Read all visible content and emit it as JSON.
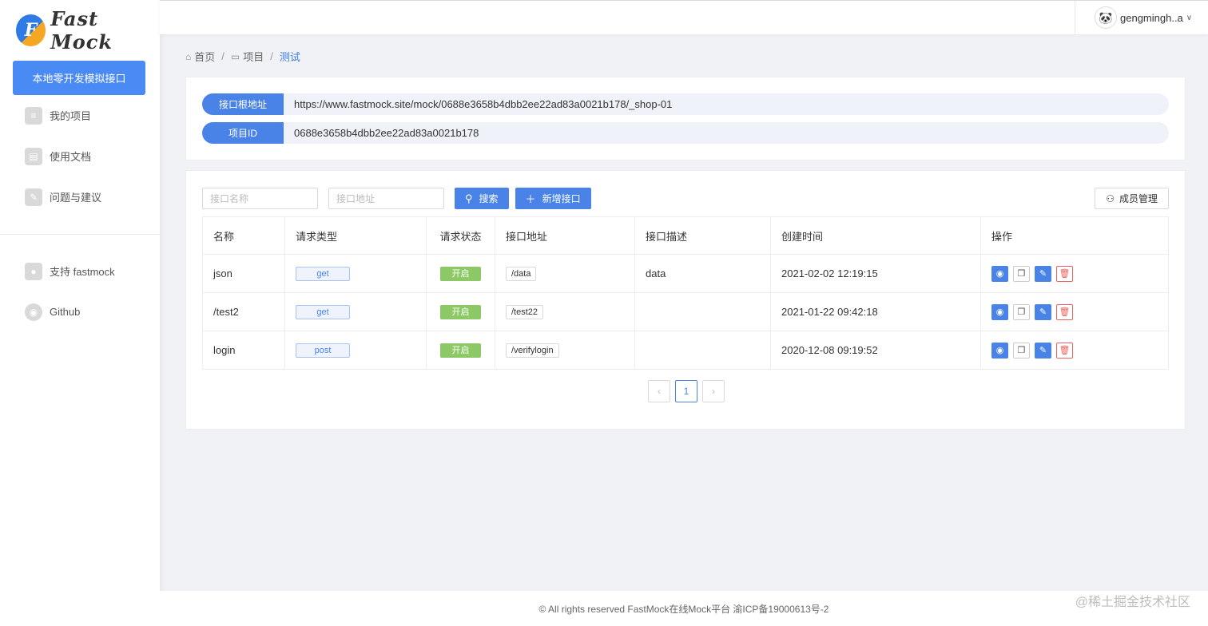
{
  "app": {
    "logo_mark": "F",
    "logo_text": "Fast Mock"
  },
  "sidebar": {
    "cta_label": "本地零开发模拟接口",
    "items": [
      {
        "label": "我的项目",
        "icon": "list-icon"
      },
      {
        "label": "使用文档",
        "icon": "book-icon"
      },
      {
        "label": "问题与建议",
        "icon": "feedback-icon"
      }
    ],
    "extra_items": [
      {
        "label": "支持 fastmock",
        "icon": "drop-icon"
      },
      {
        "label": "Github",
        "icon": "github-icon"
      }
    ]
  },
  "header": {
    "username": "gengmingh..a",
    "avatar_glyph": "🐼"
  },
  "breadcrumb": {
    "home": "首页",
    "project": "项目",
    "current": "测试"
  },
  "info": {
    "root_label": "接口根地址",
    "root_value": "https://www.fastmock.site/mock/0688e3658b4dbb2ee22ad83a0021b178/_shop-01",
    "id_label": "项目ID",
    "id_value": "0688e3658b4dbb2ee22ad83a0021b178"
  },
  "toolbar": {
    "name_placeholder": "接口名称",
    "url_placeholder": "接口地址",
    "search_label": "搜索",
    "add_label": "新增接口",
    "member_label": "成员管理"
  },
  "table": {
    "headers": [
      "名称",
      "请求类型",
      "请求状态",
      "接口地址",
      "接口描述",
      "创建时间",
      "操作"
    ],
    "rows": [
      {
        "name": "json",
        "method": "get",
        "status": "开启",
        "url": "/data",
        "desc": "data",
        "created": "2021-02-02 12:19:15"
      },
      {
        "name": "/test2",
        "method": "get",
        "status": "开启",
        "url": "/test22",
        "desc": "",
        "created": "2021-01-22 09:42:18"
      },
      {
        "name": "login",
        "method": "post",
        "status": "开启",
        "url": "/verifylogin",
        "desc": "",
        "created": "2020-12-08 09:19:52"
      }
    ]
  },
  "pagination": {
    "prev": "‹",
    "current": "1",
    "next": "›"
  },
  "footer": {
    "text": "© All rights reserved FastMock在线Mock平台 渝ICP备19000613号-2"
  },
  "watermark": "@稀土掘金技术社区",
  "colors": {
    "primary": "#4a83e8",
    "success": "#8cc865",
    "danger": "#ee6060"
  }
}
